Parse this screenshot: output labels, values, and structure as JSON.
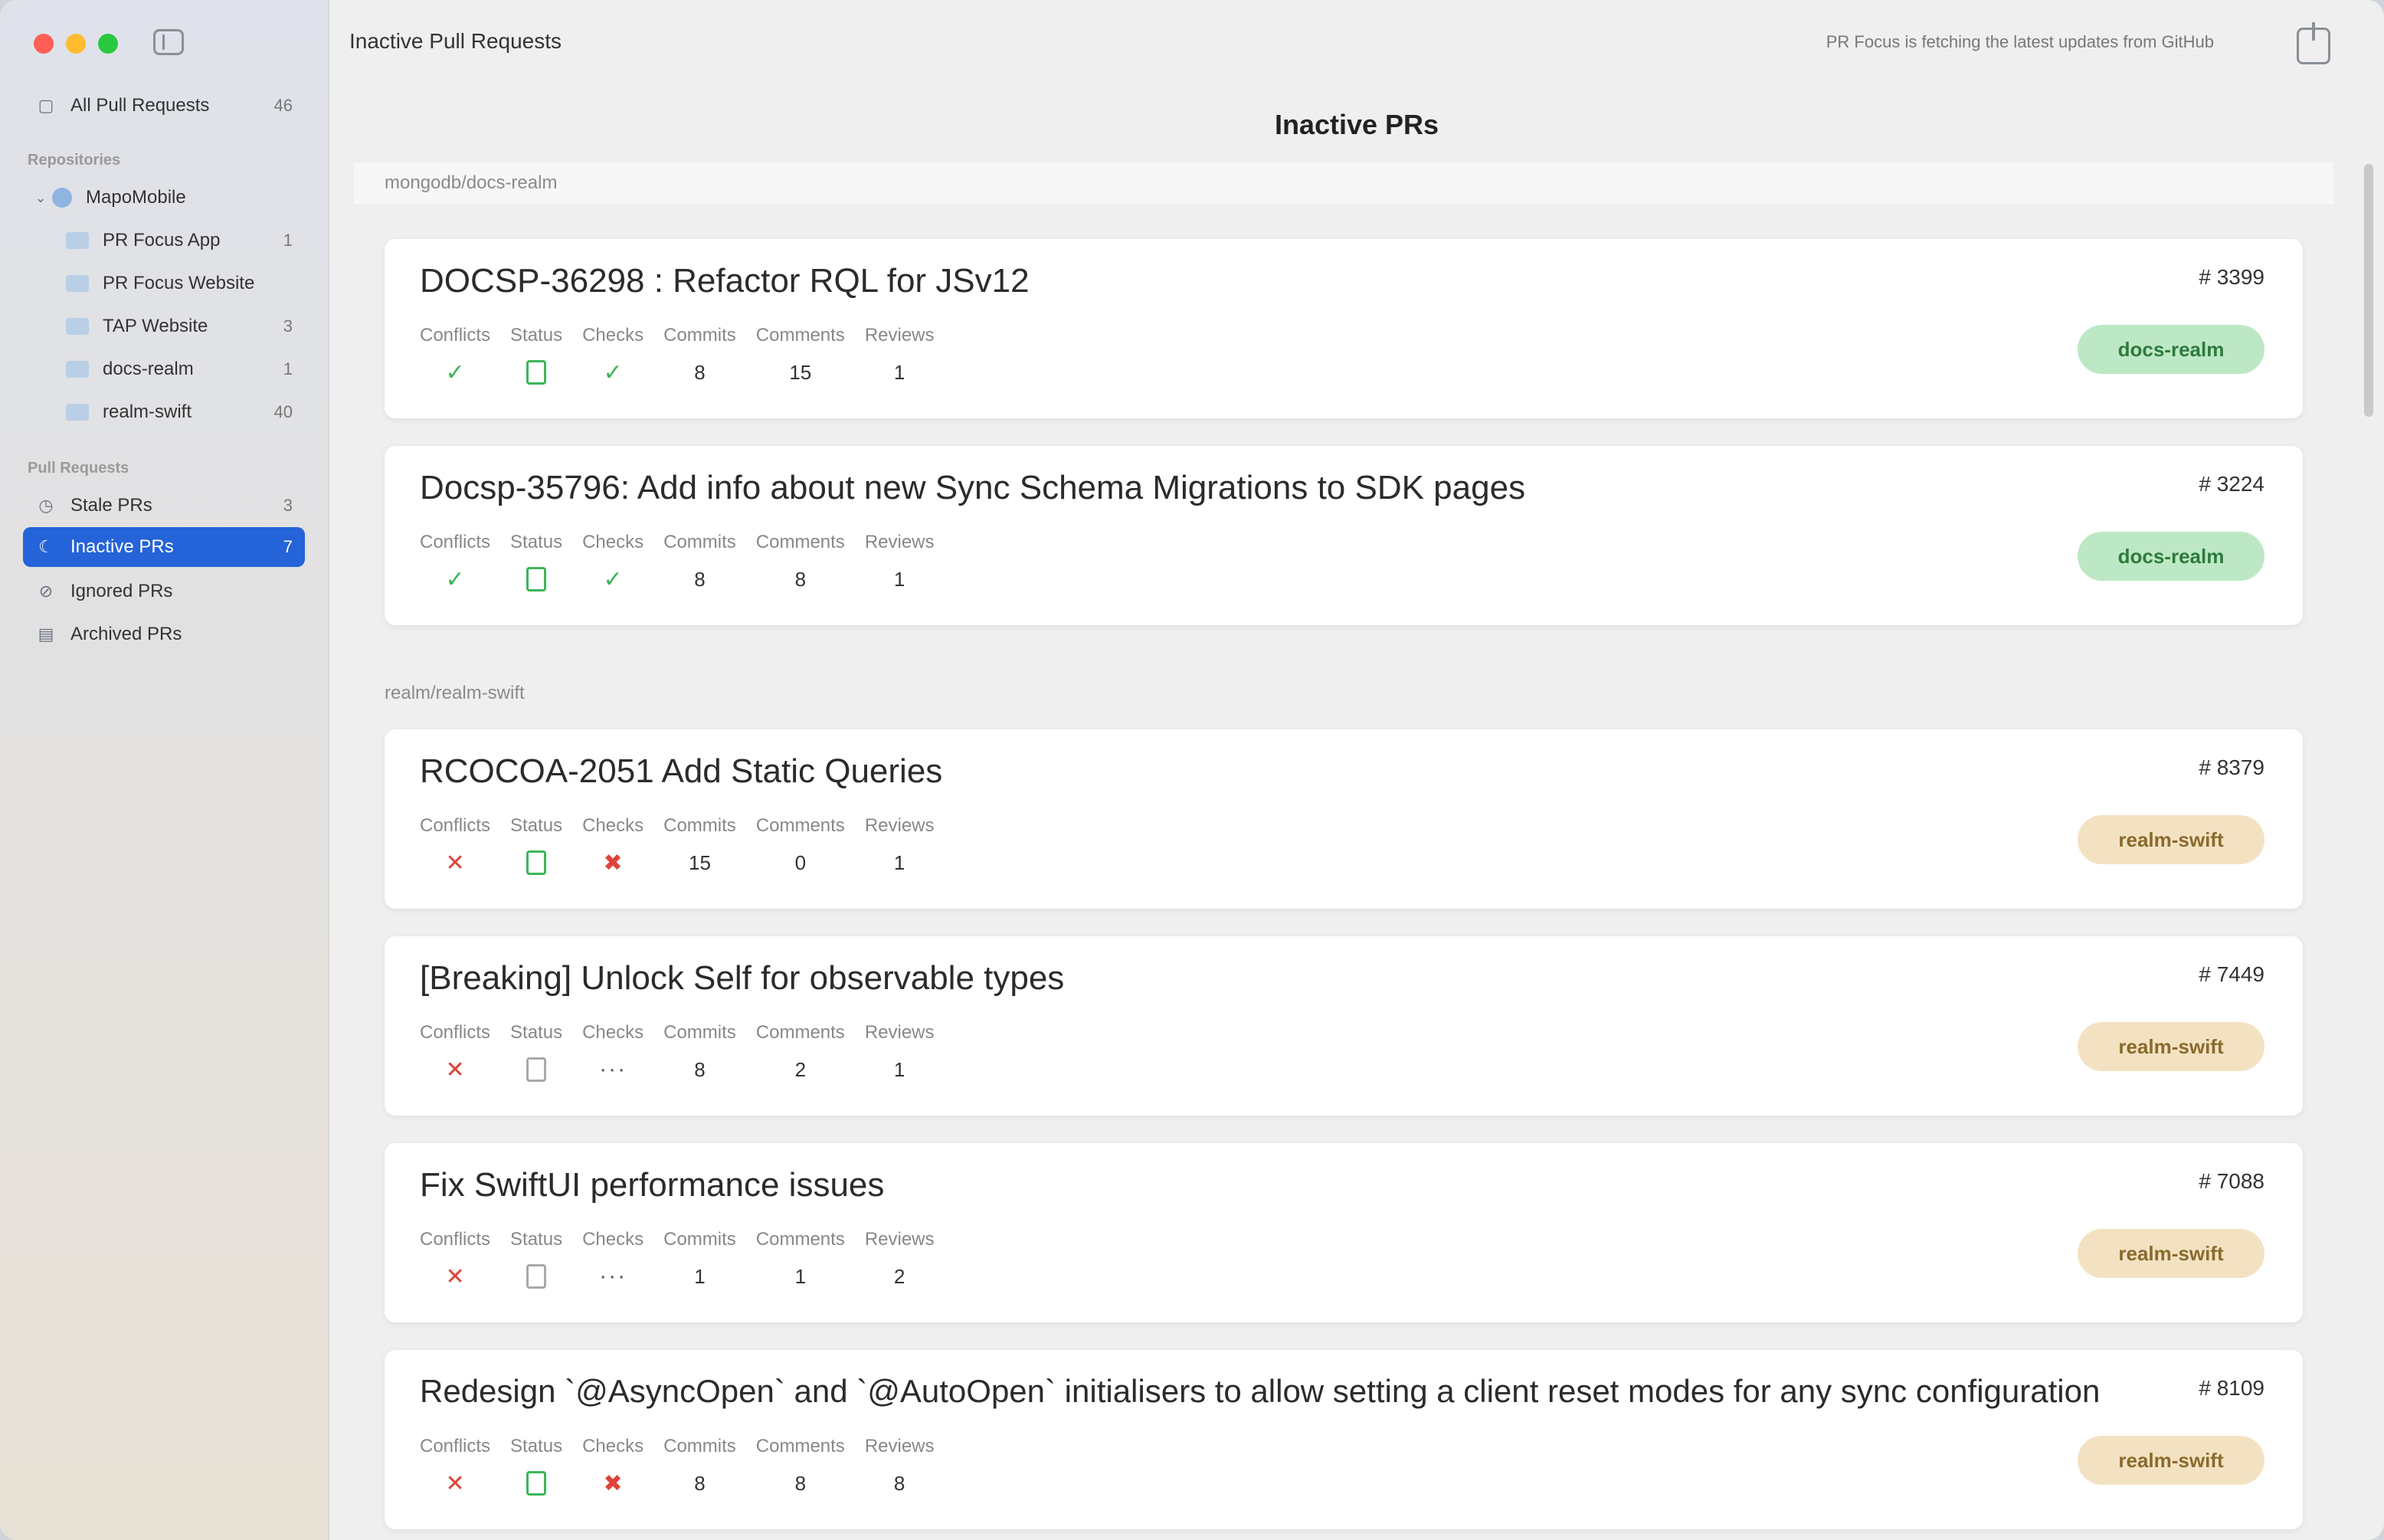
{
  "window": {
    "title": "Inactive Pull Requests",
    "status": "PR Focus is fetching the latest updates from GitHub"
  },
  "page_title": "Inactive PRs",
  "sidebar": {
    "all_item": {
      "label": "All Pull Requests",
      "count": "46"
    },
    "repos_header": "Repositories",
    "group": {
      "label": "MapoMobile"
    },
    "repos": [
      {
        "label": "PR Focus App",
        "count": "1"
      },
      {
        "label": "PR Focus Website",
        "count": ""
      },
      {
        "label": "TAP Website",
        "count": "3"
      },
      {
        "label": "docs-realm",
        "count": "1"
      },
      {
        "label": "realm-swift",
        "count": "40"
      }
    ],
    "prs_header": "Pull Requests",
    "pr_items": [
      {
        "label": "Stale PRs",
        "count": "3"
      },
      {
        "label": "Inactive PRs",
        "count": "7"
      },
      {
        "label": "Ignored PRs",
        "count": ""
      },
      {
        "label": "Archived PRs",
        "count": ""
      }
    ]
  },
  "stat_labels": [
    "Conflicts",
    "Status",
    "Checks",
    "Commits",
    "Comments",
    "Reviews"
  ],
  "groups": [
    {
      "repo": "mongodb/docs-realm",
      "badge": "docs-realm",
      "badge_color": "#bde8c5",
      "cards": [
        {
          "title": "DOCSP-36298 : Refactor RQL for JSv12",
          "number": "# 3399",
          "conflicts": "ok",
          "status": "ok",
          "checks": "ok",
          "commits": "8",
          "comments": "15",
          "reviews": "1"
        },
        {
          "title": "Docsp-35796: Add info about new Sync Schema Migrations to SDK pages",
          "number": "# 3224",
          "conflicts": "ok",
          "status": "ok",
          "checks": "ok",
          "commits": "8",
          "comments": "8",
          "reviews": "1"
        }
      ]
    },
    {
      "repo": "realm/realm-swift",
      "badge": "realm-swift",
      "badge_color": "#f3e2c2",
      "cards": [
        {
          "title": "RCOCOA-2051 Add Static Queries",
          "number": "# 8379",
          "conflicts": "fail",
          "status": "ok",
          "checks": "fail",
          "commits": "15",
          "comments": "0",
          "reviews": "1"
        },
        {
          "title": "[Breaking] Unlock Self for observable types",
          "number": "# 7449",
          "conflicts": "fail",
          "status": "pending",
          "checks": "pending",
          "commits": "8",
          "comments": "2",
          "reviews": "1"
        },
        {
          "title": "Fix SwiftUI performance issues",
          "number": "# 7088",
          "conflicts": "fail",
          "status": "pending",
          "checks": "pending",
          "commits": "1",
          "comments": "1",
          "reviews": "2"
        },
        {
          "title": "Redesign `@AsyncOpen` and `@AutoOpen` initialisers to allow setting a client reset modes for any sync configuration",
          "number": "# 8109",
          "conflicts": "fail",
          "status": "ok",
          "checks": "fail",
          "commits": "8",
          "comments": "8",
          "reviews": "8"
        }
      ]
    }
  ]
}
